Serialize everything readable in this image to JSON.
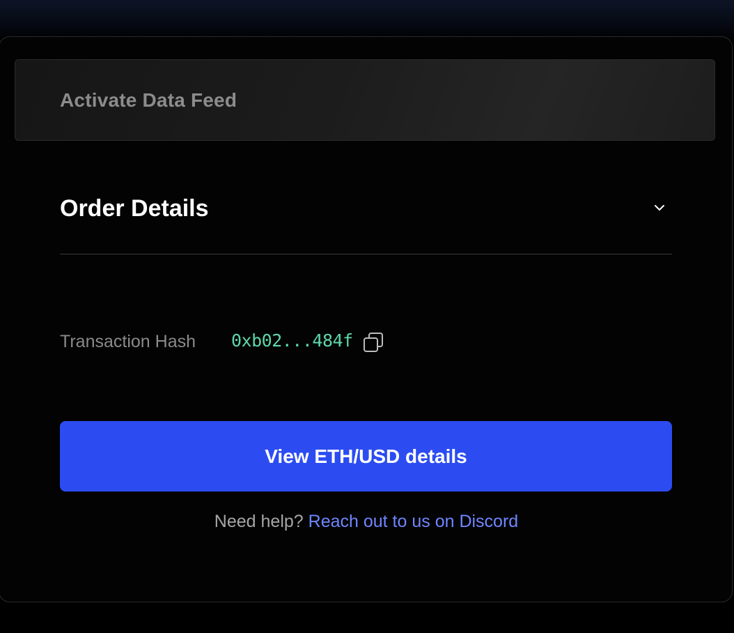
{
  "step_banner": {
    "title": "Activate Data Feed"
  },
  "order_details": {
    "title": "Order Details",
    "expanded": true
  },
  "transaction": {
    "label": "Transaction Hash",
    "hash": "0xb02...484f",
    "hash_color": "#5ed6ab"
  },
  "primary_action": {
    "label": "View ETH/USD details",
    "color": "#2c4cf2"
  },
  "help": {
    "prefix": "Need help?",
    "link_text": "Reach out to us on Discord",
    "link_color": "#6f86ff"
  },
  "icons": {
    "chevron": "chevron-down-icon",
    "copy": "copy-icon"
  }
}
